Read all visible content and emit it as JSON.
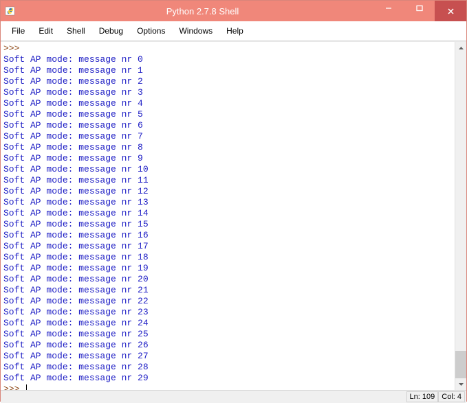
{
  "titlebar": {
    "title": "Python 2.7.8 Shell"
  },
  "menu": {
    "items": [
      "File",
      "Edit",
      "Shell",
      "Debug",
      "Options",
      "Windows",
      "Help"
    ]
  },
  "editor": {
    "prompt": ">>>",
    "message_prefix": "Soft AP mode: message nr",
    "lines": [
      "Soft AP mode: message nr 0",
      "Soft AP mode: message nr 1",
      "Soft AP mode: message nr 2",
      "Soft AP mode: message nr 3",
      "Soft AP mode: message nr 4",
      "Soft AP mode: message nr 5",
      "Soft AP mode: message nr 6",
      "Soft AP mode: message nr 7",
      "Soft AP mode: message nr 8",
      "Soft AP mode: message nr 9",
      "Soft AP mode: message nr 10",
      "Soft AP mode: message nr 11",
      "Soft AP mode: message nr 12",
      "Soft AP mode: message nr 13",
      "Soft AP mode: message nr 14",
      "Soft AP mode: message nr 15",
      "Soft AP mode: message nr 16",
      "Soft AP mode: message nr 17",
      "Soft AP mode: message nr 18",
      "Soft AP mode: message nr 19",
      "Soft AP mode: message nr 20",
      "Soft AP mode: message nr 21",
      "Soft AP mode: message nr 22",
      "Soft AP mode: message nr 23",
      "Soft AP mode: message nr 24",
      "Soft AP mode: message nr 25",
      "Soft AP mode: message nr 26",
      "Soft AP mode: message nr 27",
      "Soft AP mode: message nr 28",
      "Soft AP mode: message nr 29"
    ]
  },
  "statusbar": {
    "line": "Ln: 109",
    "col": "Col: 4"
  }
}
